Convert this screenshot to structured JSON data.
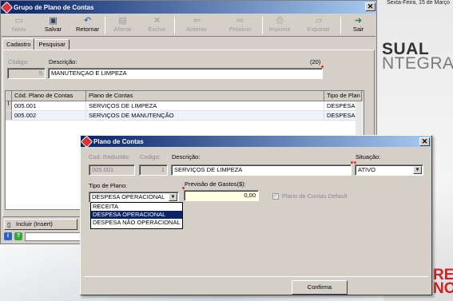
{
  "background": {
    "date_text": "Sexta-Feira, 15 de Março",
    "logo_line1": "SUAL",
    "logo_line2": "NTEGRA",
    "corner_text": "RE NO"
  },
  "main_window": {
    "title": "Grupo de Plano de Contas",
    "toolbar": [
      {
        "label": "Novo",
        "icon": "new-icon",
        "enabled": false
      },
      {
        "label": "Salvar",
        "icon": "save-icon",
        "enabled": true
      },
      {
        "label": "Retornar",
        "icon": "undo-icon",
        "enabled": true
      },
      {
        "label": "Alterar",
        "icon": "edit-icon",
        "enabled": false
      },
      {
        "label": "Excluir",
        "icon": "delete-icon",
        "enabled": false
      },
      {
        "label": "Anterior",
        "icon": "arrow-left-icon",
        "enabled": false
      },
      {
        "label": "Próximo",
        "icon": "arrow-right-icon",
        "enabled": false
      },
      {
        "label": "Imprimir",
        "icon": "print-icon",
        "enabled": false
      },
      {
        "label": "Exportar",
        "icon": "export-icon",
        "enabled": false
      },
      {
        "label": "Sair",
        "icon": "exit-icon",
        "enabled": true
      }
    ],
    "tabs": [
      "Cadastro",
      "Pesquisar"
    ],
    "form": {
      "codigo_label": "Código:",
      "codigo_value": "5",
      "descricao_label": "Descrição:",
      "descricao_value": "MANUTENÇAO E LIMPEZA",
      "max_len": "(20)"
    },
    "grid": {
      "columns": [
        "Cód. Plano de Contas",
        "Plano de Contas",
        "Tipo de Plan"
      ],
      "rows": [
        {
          "indicator": "I",
          "codigo": "005.001",
          "plano": "SERVIÇOS DE LIMPEZA",
          "tipo": "DESPESA O"
        },
        {
          "indicator": "",
          "codigo": "005.002",
          "plano": "SERVIÇOS DE MANUTENÇÃO",
          "tipo": "DESPESA O"
        }
      ]
    },
    "bottom": {
      "insert_label": "Incluir (Insert)"
    }
  },
  "dialog": {
    "title": "Plano de Contas",
    "cod_reduzido_label": "Cod. Reduzido:",
    "cod_reduzido_value": "005.001",
    "codigo_label": "Codigo:",
    "codigo_value": "1",
    "descricao_label": "Descrição:",
    "descricao_value": "SERVIÇOS DE LIMPEZA",
    "situacao_label": "Situação:",
    "situacao_value": "ATIVO",
    "tipo_label": "Tipo de Plano:",
    "tipo_value": "DESPESA OPERACIONAL",
    "tipo_options": [
      "RECEITA",
      "DESPESA OPERACIONAL",
      "DESPESA NÃO OPERACIONAL"
    ],
    "previsao_label": "Previsão de Gastos($):",
    "previsao_value": "0,00",
    "default_label": "Plano de Contas Default",
    "confirm_label": "Confirma"
  },
  "colors": {
    "titlebar_start": "#0a246a",
    "titlebar_end": "#a6caf0",
    "face": "#d4d0c8",
    "required_marker": "#e03030",
    "selection": "#0a246a",
    "highlight_input": "#ffffe0"
  }
}
